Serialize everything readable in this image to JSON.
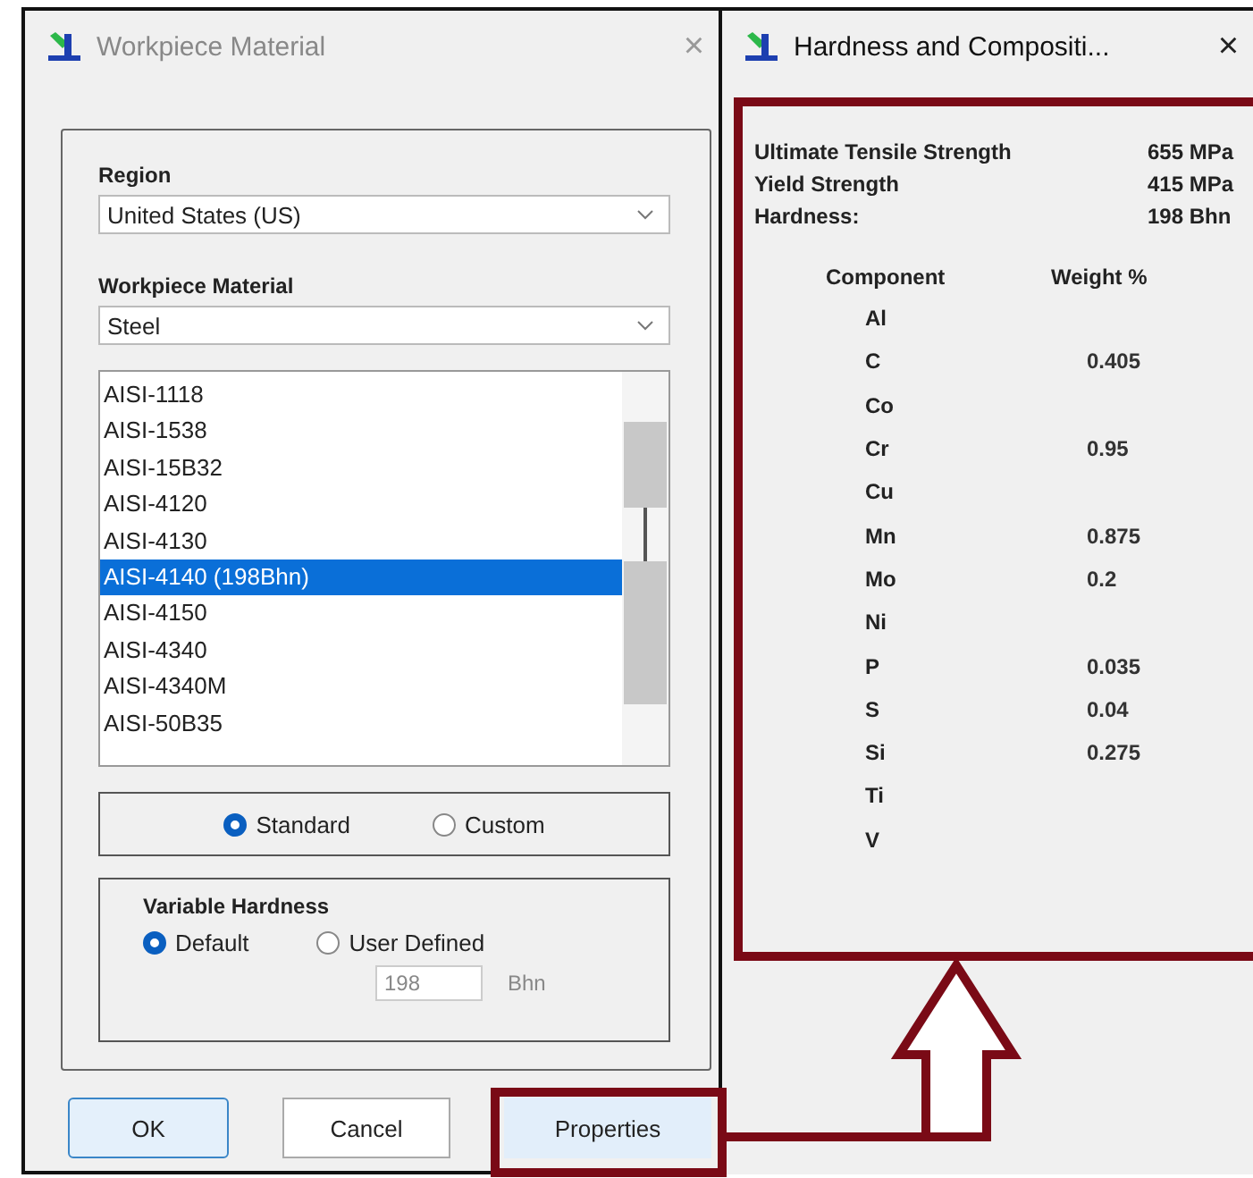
{
  "material_window": {
    "title": "Workpiece Material",
    "close": "×",
    "region": {
      "label": "Region",
      "value": "United States (US)"
    },
    "material": {
      "label": "Workpiece Material",
      "value": "Steel"
    },
    "grades": [
      {
        "label": "AISI-1118",
        "selected": false
      },
      {
        "label": "AISI-1538",
        "selected": false
      },
      {
        "label": "AISI-15B32",
        "selected": false
      },
      {
        "label": "AISI-4120",
        "selected": false
      },
      {
        "label": "AISI-4130",
        "selected": false
      },
      {
        "label": "AISI-4140 (198Bhn)",
        "selected": true
      },
      {
        "label": "AISI-4150",
        "selected": false
      },
      {
        "label": "AISI-4340",
        "selected": false
      },
      {
        "label": "AISI-4340M",
        "selected": false
      },
      {
        "label": "AISI-50B35",
        "selected": false
      }
    ],
    "source": [
      {
        "label": "Standard",
        "selected": true
      },
      {
        "label": "Custom",
        "selected": false
      }
    ],
    "hardness": {
      "title": "Variable Hardness",
      "options": [
        {
          "label": "Default",
          "selected": true
        },
        {
          "label": "User Defined",
          "selected": false
        }
      ],
      "value": "198",
      "unit": "Bhn"
    },
    "buttons": [
      "OK",
      "Cancel",
      "Properties"
    ]
  },
  "composition_window": {
    "title": "Hardness and Compositi...",
    "close": "×",
    "properties": [
      {
        "label": "Ultimate Tensile Strength",
        "value": "655 MPa"
      },
      {
        "label": "Yield Strength",
        "value": "415 MPa"
      },
      {
        "label": "Hardness:",
        "value": "198 Bhn"
      }
    ],
    "columns": [
      "Component",
      "Weight %"
    ],
    "rows": [
      {
        "component": "Al"
      },
      {
        "component": "C",
        "weight": "0.405"
      },
      {
        "component": "Co"
      },
      {
        "component": "Cr",
        "weight": "0.95"
      },
      {
        "component": "Cu"
      },
      {
        "component": "Mn",
        "weight": "0.875"
      },
      {
        "component": "Mo",
        "weight": "0.2"
      },
      {
        "component": "Ni"
      },
      {
        "component": "P",
        "weight": "0.035"
      },
      {
        "component": "S",
        "weight": "0.04"
      },
      {
        "component": "Si",
        "weight": "0.275"
      },
      {
        "component": "Ti"
      },
      {
        "component": "V"
      }
    ]
  }
}
